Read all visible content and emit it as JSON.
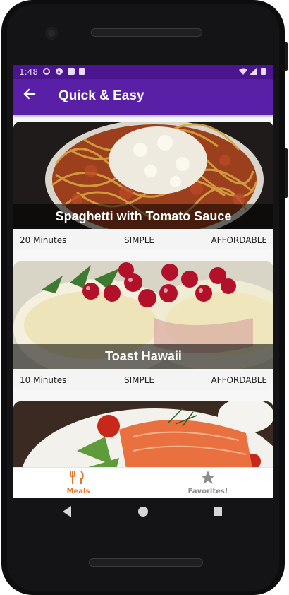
{
  "status_bar": {
    "time": "1:48"
  },
  "app_bar": {
    "title": "Quick & Easy",
    "back_icon": "arrow-back-icon"
  },
  "meals": [
    {
      "title": "Spaghetti with Tomato Sauce",
      "duration": "20 Minutes",
      "complexity": "SIMPLE",
      "affordability": "AFFORDABLE"
    },
    {
      "title": "Toast Hawaii",
      "duration": "10 Minutes",
      "complexity": "SIMPLE",
      "affordability": "AFFORDABLE"
    },
    {
      "title": "",
      "duration": "",
      "complexity": "",
      "affordability": ""
    }
  ],
  "bottom_nav": {
    "items": [
      {
        "label": "Meals",
        "icon": "restaurant-icon",
        "active": true
      },
      {
        "label": "Favorites!",
        "icon": "star-icon",
        "active": false
      }
    ]
  },
  "colors": {
    "primary": "#5a1fa7",
    "primary_dark": "#4a158f",
    "accent": "#e8732a",
    "inactive": "#8c8c8c"
  }
}
